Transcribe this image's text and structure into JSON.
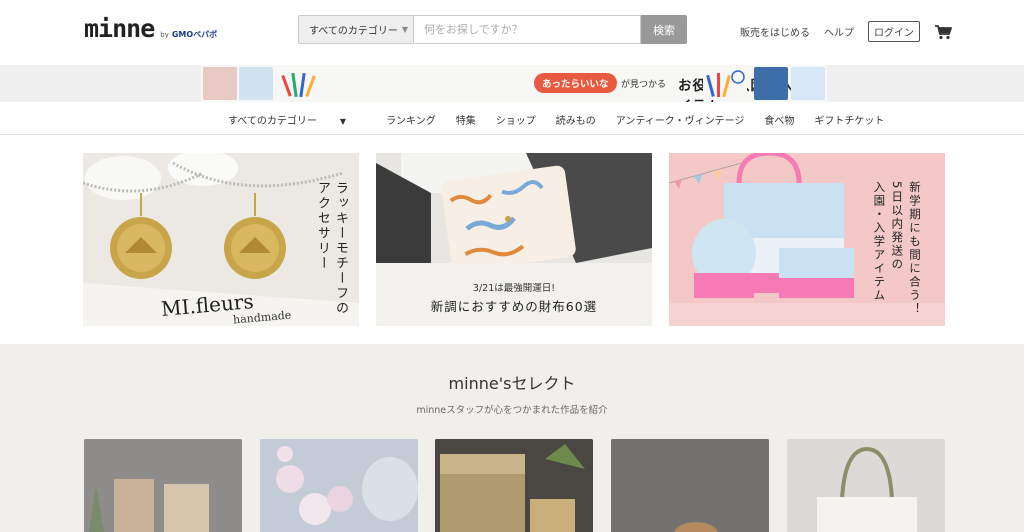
{
  "brand": {
    "name": "minne",
    "by": "by",
    "company": "GMOペパボ"
  },
  "search": {
    "category_label": "すべてのカテゴリー",
    "placeholder": "何をお探しですか？",
    "button_label": "検索"
  },
  "header_links": {
    "sell": "販売をはじめる",
    "help": "ヘルプ",
    "login": "ログイン"
  },
  "banner": {
    "pill": "あったらいいな",
    "pill_after": "が見つかる",
    "title_a": "お役立ち入園",
    "title_dot": "・",
    "title_b": "入学アイテム"
  },
  "nav": {
    "items": [
      "すべてのカテゴリー",
      "ランキング",
      "特集",
      "ショップ",
      "読みもの",
      "アンティーク・ヴィンテージ",
      "食べ物",
      "ギフトチケット"
    ]
  },
  "features": [
    {
      "vertical": "ラッキーモチーフの\nアクセサリー",
      "photo_text_1": "MI.fleurs",
      "photo_text_2": "handmade"
    },
    {
      "caption_small": "3/21は最強開運日!",
      "caption_main": "新調におすすめの財布60選"
    },
    {
      "vertical": "新学期にも間に合う！\n5日以内発送の\n入園・入学アイテム"
    }
  ],
  "select": {
    "title": "minne'sセレクト",
    "subtitle": "minneスタッフが心をつかまれた作品を紹介"
  },
  "colors": {
    "accent": "#e75a3f",
    "search_button": "#999999",
    "section_bg": "#f1efec"
  }
}
